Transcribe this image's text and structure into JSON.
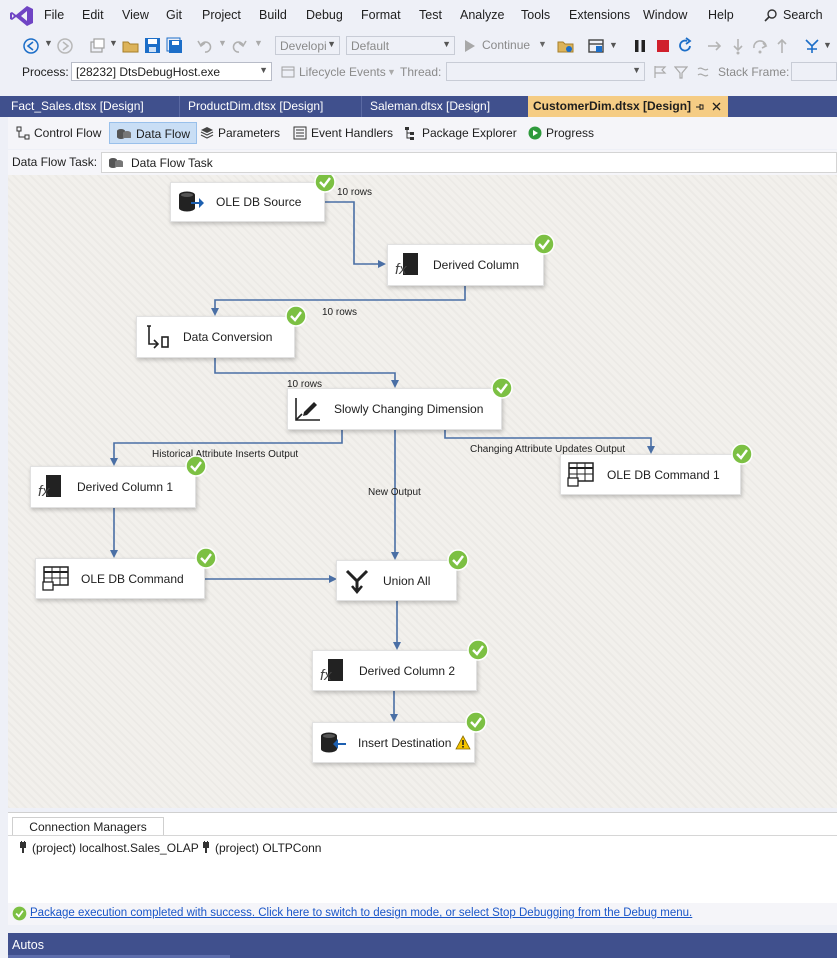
{
  "menu": {
    "items": [
      "File",
      "Edit",
      "View",
      "Git",
      "Project",
      "Build",
      "Debug",
      "Format",
      "Test",
      "Analyze",
      "Tools",
      "Extensions",
      "Window",
      "Help"
    ],
    "search_label": "Search"
  },
  "toolbar": {
    "config_combo": "Developi",
    "platform_combo": "Default",
    "continue_label": "Continue"
  },
  "debugbar": {
    "process_label": "Process:",
    "process_value": "[28232] DtsDebugHost.exe",
    "lifecycle_label": "Lifecycle Events",
    "thread_label": "Thread:",
    "stackframe_label": "Stack Frame:"
  },
  "doc_tabs": [
    {
      "label": "Fact_Sales.dtsx [Design]"
    },
    {
      "label": "ProductDim.dtsx [Design]"
    },
    {
      "label": "Saleman.dtsx [Design]"
    },
    {
      "label": "CustomerDim.dtsx [Design]",
      "active": true
    }
  ],
  "designer_tabs": [
    "Control Flow",
    "Data Flow",
    "Parameters",
    "Event Handlers",
    "Package Explorer",
    "Progress"
  ],
  "task": {
    "label": "Data Flow Task:",
    "value": "Data Flow Task"
  },
  "nodes": {
    "ole_db_source": "OLE DB Source",
    "derived_column": "Derived Column",
    "data_conversion": "Data Conversion",
    "scd": "Slowly Changing Dimension",
    "derived_column_1": "Derived Column 1",
    "ole_db_command_1": "OLE DB Command 1",
    "ole_db_command": "OLE DB Command",
    "union_all": "Union All",
    "derived_column_2": "Derived Column 2",
    "insert_destination": "Insert Destination"
  },
  "paths": {
    "rows_1": "10 rows",
    "rows_2": "10 rows",
    "rows_3": "10 rows",
    "historical": "Historical Attribute Inserts Output",
    "changing": "Changing Attribute Updates Output",
    "new_output": "New Output"
  },
  "connection_managers": {
    "tab_label": "Connection Managers",
    "items": [
      "(project) localhost.Sales_OLAP",
      "(project) OLTPConn"
    ]
  },
  "status": {
    "message": "Package execution completed with success. Click here to switch to design mode, or select Stop Debugging from the Debug menu."
  },
  "autos": {
    "label": "Autos"
  },
  "colors": {
    "accent_blue": "#40508d",
    "active_tab": "#f5cc84",
    "success_green": "#7cc043",
    "link": "#1a56c8"
  }
}
